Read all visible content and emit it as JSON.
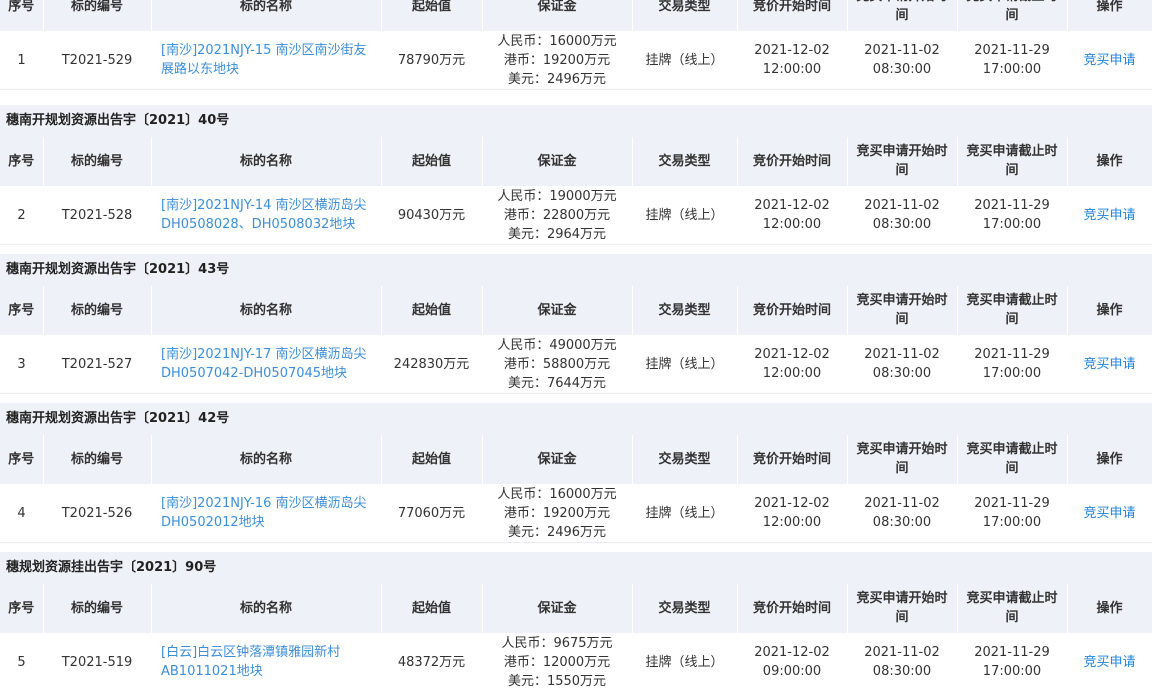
{
  "headers": {
    "seq": "序号",
    "code": "标的编号",
    "name": "标的名称",
    "start": "起始值",
    "deposit": "保证金",
    "trade": "交易类型",
    "bid_start": "竞价开始时间",
    "apply_start": "竞买申请开始时间",
    "apply_end": "竞买申请截止时间",
    "op": "操作"
  },
  "blocks": [
    {
      "notice": "",
      "row": {
        "seq": "1",
        "code": "T2021-529",
        "name": "[南沙]2021NJY-15 南沙区南沙街友展路以东地块",
        "start": "78790万元",
        "deposit": [
          "人民币：16000万元",
          "港币：19200万元",
          "美元：2496万元"
        ],
        "trade": "挂牌（线上）",
        "bid_start": "2021-12-02 12:00:00",
        "apply_start": "2021-11-02 08:30:00",
        "apply_end": "2021-11-29 17:00:00",
        "op": "竞买申请"
      }
    },
    {
      "notice": "穗南开规划资源出告宇〔2021〕40号",
      "row": {
        "seq": "2",
        "code": "T2021-528",
        "name": "[南沙]2021NJY-14 南沙区横沥岛尖DH0508028、DH0508032地块",
        "start": "90430万元",
        "deposit": [
          "人民币：19000万元",
          "港币：22800万元",
          "美元：2964万元"
        ],
        "trade": "挂牌（线上）",
        "bid_start": "2021-12-02 12:00:00",
        "apply_start": "2021-11-02 08:30:00",
        "apply_end": "2021-11-29 17:00:00",
        "op": "竞买申请"
      }
    },
    {
      "notice": "穗南开规划资源出告宇〔2021〕43号",
      "row": {
        "seq": "3",
        "code": "T2021-527",
        "name": "[南沙]2021NJY-17 南沙区横沥岛尖DH0507042-DH0507045地块",
        "start": "242830万元",
        "deposit": [
          "人民币：49000万元",
          "港币：58800万元",
          "美元：7644万元"
        ],
        "trade": "挂牌（线上）",
        "bid_start": "2021-12-02 12:00:00",
        "apply_start": "2021-11-02 08:30:00",
        "apply_end": "2021-11-29 17:00:00",
        "op": "竞买申请"
      }
    },
    {
      "notice": "穗南开规划资源出告宇〔2021〕42号",
      "row": {
        "seq": "4",
        "code": "T2021-526",
        "name": "[南沙]2021NJY-16 南沙区横沥岛尖DH0502012地块",
        "start": "77060万元",
        "deposit": [
          "人民币：16000万元",
          "港币：19200万元",
          "美元：2496万元"
        ],
        "trade": "挂牌（线上）",
        "bid_start": "2021-12-02 12:00:00",
        "apply_start": "2021-11-02 08:30:00",
        "apply_end": "2021-11-29 17:00:00",
        "op": "竞买申请"
      }
    },
    {
      "notice": "穗规划资源挂出告宇〔2021〕90号",
      "row": {
        "seq": "5",
        "code": "T2021-519",
        "name": "[白云]白云区钟落潭镇雅园新村AB1011021地块",
        "start": "48372万元",
        "deposit": [
          "人民币：9675万元",
          "港币：12000万元",
          "美元：1550万元"
        ],
        "trade": "挂牌（线上）",
        "bid_start": "2021-12-02 09:00:00",
        "apply_start": "2021-11-02 08:30:00",
        "apply_end": "2021-11-29 17:00:00",
        "op": "竞买申请"
      }
    }
  ]
}
